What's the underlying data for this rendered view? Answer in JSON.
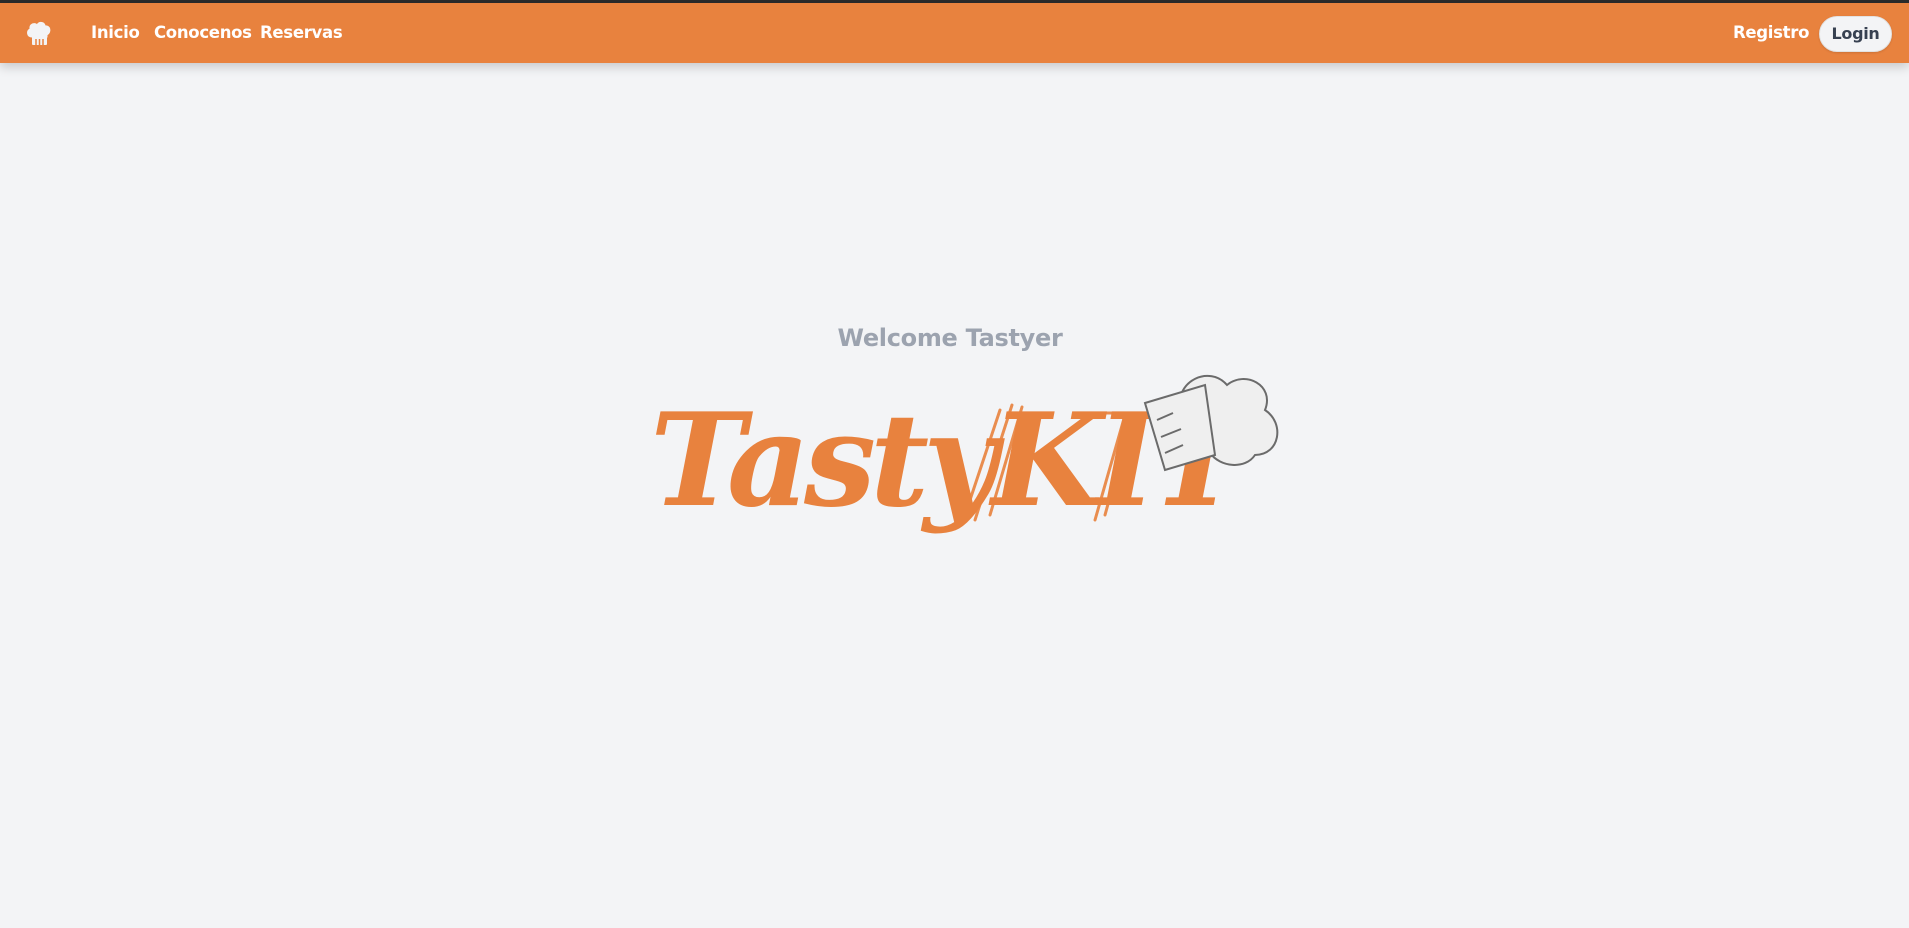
{
  "nav": {
    "links": [
      "Inicio",
      "Conocenos",
      "Reservas"
    ],
    "register_label": "Registro",
    "login_label": "Login",
    "logo_icon": "chef-hat-icon"
  },
  "hero": {
    "welcome_text": "Welcome Tastyer",
    "brand_logo": {
      "text": "TastyKIT",
      "icon": "chef-hat-icon"
    }
  },
  "colors": {
    "brand_orange": "#e8823e",
    "background": "#f3f4f6",
    "welcome_gray": "#9ca3af",
    "login_text": "#374151"
  }
}
